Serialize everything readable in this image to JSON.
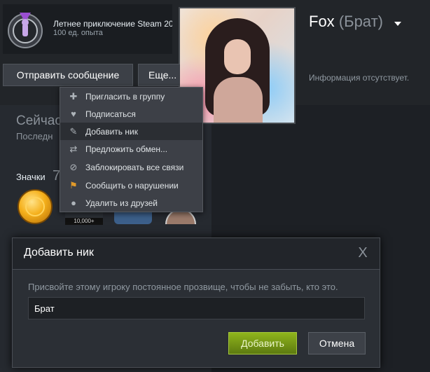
{
  "badge": {
    "title": "Летнее приключение Steam 20",
    "xp": "100 ед. опыта"
  },
  "profile": {
    "name": "Fox",
    "nickname": "(Брат)",
    "info": "Информация отсутствует."
  },
  "buttons": {
    "send_message": "Отправить сообщение",
    "more": "Еще..."
  },
  "status": {
    "title": "Сейчас",
    "subtitle": "Последн"
  },
  "badges_section": {
    "label": "Значки",
    "count": "7",
    "badge_2_text": "10,000+"
  },
  "context_menu": {
    "items": [
      {
        "label": "Пригласить в группу",
        "icon": "invite-icon"
      },
      {
        "label": "Подписаться",
        "icon": "heart-icon"
      },
      {
        "label": "Добавить ник",
        "icon": "pencil-icon"
      },
      {
        "label": "Предложить обмен...",
        "icon": "trade-icon"
      },
      {
        "label": "Заблокировать все связи",
        "icon": "block-icon"
      },
      {
        "label": "Сообщить о нарушении",
        "icon": "flag-icon"
      },
      {
        "label": "Удалить из друзей",
        "icon": "user-remove-icon"
      }
    ],
    "active_index": 2
  },
  "dialog": {
    "title": "Добавить ник",
    "description": "Присвойте этому игроку постоянное прозвище, чтобы не забыть, кто это.",
    "input_value": "Брат",
    "add_label": "Добавить",
    "cancel_label": "Отмена",
    "close_glyph": "X"
  },
  "colors": {
    "accent_green": "#8fb51c",
    "background": "#1b1e22"
  }
}
